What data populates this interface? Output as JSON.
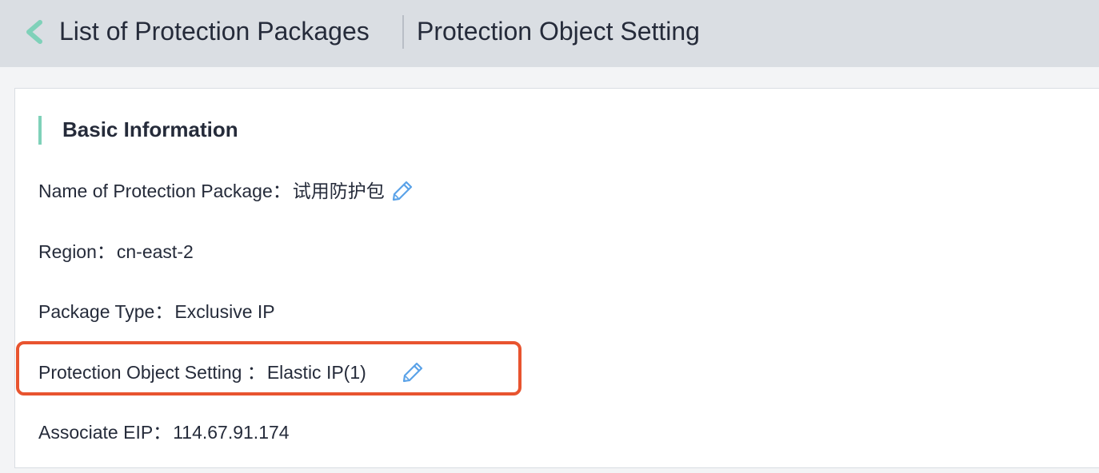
{
  "header": {
    "back_icon": "chevron-left-icon",
    "back_color": "#7fd1b9",
    "list_label": "List of Protection Packages",
    "current_label": "Protection Object Setting"
  },
  "section": {
    "title": "Basic Information",
    "accent_color": "#7fd1b9"
  },
  "info": {
    "name_label": "Name of Protection Package：",
    "name_value": "试用防护包",
    "region_label": "Region：",
    "region_value": "cn-east-2",
    "type_label": "Package Type：",
    "type_value": "Exclusive IP",
    "protect_label": "Protection Object Setting ：",
    "protect_value": "Elastic IP(1)",
    "eip_label": "Associate EIP：",
    "eip_value": "114.67.91.174"
  },
  "icons": {
    "edit_icon": "pencil-icon",
    "edit_color": "#5aa2e8",
    "highlight_color": "#e8542f"
  }
}
